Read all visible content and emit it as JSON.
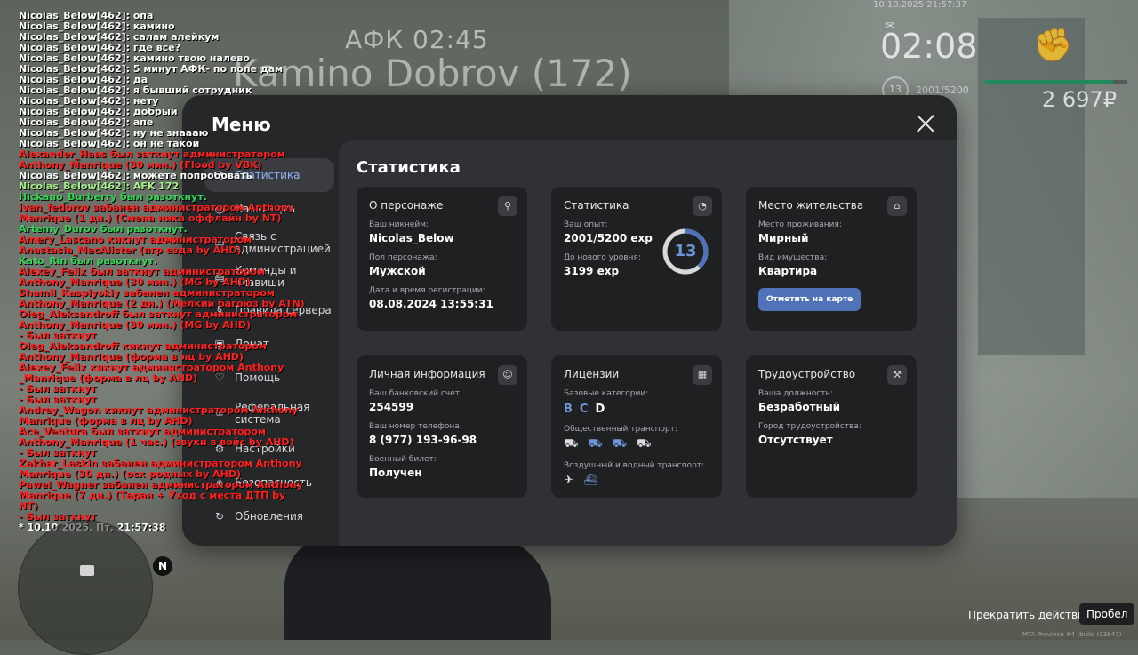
{
  "overlay": {
    "afk": "АФК 02:45",
    "nametag": "Kamino Dobrov (172)"
  },
  "hud": {
    "date": "10.10.2025 21:57:37",
    "time": "02:08",
    "level": "13",
    "exp": "2001/5200",
    "money": "2 697₽",
    "mail_icon": "mail-icon",
    "fist_icon": "fist-icon"
  },
  "menu": {
    "title": "Меню",
    "sidebar": [
      {
        "label": "Статистика",
        "icon": "chart-icon",
        "active": true
      },
      {
        "label": "Навигация",
        "icon": "compass-icon"
      },
      {
        "label": "Связь с администрацией",
        "icon": "chat-icon"
      },
      {
        "label": "Команды и клавиши",
        "icon": "keyboard-icon"
      },
      {
        "label": "Правила сервера",
        "icon": "rules-icon"
      },
      {
        "label": "Донат",
        "icon": "wallet-icon"
      },
      {
        "label": "Помощь",
        "icon": "help-icon"
      },
      {
        "label": "Реферальная система",
        "icon": "referral-icon"
      },
      {
        "label": "Настройки",
        "icon": "gear-icon"
      },
      {
        "label": "Безопасность",
        "icon": "shield-icon"
      },
      {
        "label": "Обновления",
        "icon": "refresh-icon"
      }
    ]
  },
  "stats": {
    "title": "Статистика",
    "character": {
      "title": "О персонаже",
      "nick_label": "Ваш никнейм:",
      "nick": "Nicolas_Below",
      "gender_label": "Пол персонажа:",
      "gender": "Мужской",
      "reg_label": "Дата и время регистрации:",
      "reg": "08.08.2024 13:55:31"
    },
    "statistics": {
      "title": "Статистика",
      "exp_label": "Ваш опыт:",
      "exp": "2001/5200 exp",
      "next_label": "До нового уровня:",
      "next": "3199 exp",
      "level": "13",
      "progress": 0.3848
    },
    "residence": {
      "title": "Место жительства",
      "place_label": "Место проживания:",
      "place": "Мирный",
      "property_label": "Вид имущества:",
      "property": "Квартира",
      "map_button": "Отметить на карте"
    },
    "personal": {
      "title": "Личная информация",
      "bank_label": "Ваш банковский счет:",
      "bank": "254599",
      "phone_label": "Ваш номер телефона:",
      "phone": "8 (977) 193-96-98",
      "military_label": "Военный билет:",
      "military": "Получен"
    },
    "licenses": {
      "title": "Лицензии",
      "base_label": "Базовые категории:",
      "cat_b": "B",
      "cat_c": "C",
      "cat_d": "D",
      "public_label": "Общественный транспорт:",
      "air_label": "Воздушный и водный транспорт:"
    },
    "employment": {
      "title": "Трудоустройство",
      "position_label": "Ваша должность:",
      "position": "Безработный",
      "city_label": "Город трудоустройства:",
      "city": "Отсутствует"
    }
  },
  "chat": [
    {
      "t": "Nicolas_Below[462]: опа",
      "c": "w"
    },
    {
      "t": "Nicolas_Below[462]: камино",
      "c": "w"
    },
    {
      "t": "Nicolas_Below[462]: салам алейкум",
      "c": "w"
    },
    {
      "t": "Nicolas_Below[462]: где все?",
      "c": "w"
    },
    {
      "t": "Nicolas_Below[462]: камино твою налево",
      "c": "w"
    },
    {
      "t": "Nicolas_Below[462]: 5 минут АФК- по попе дам",
      "c": "w"
    },
    {
      "t": "Nicolas_Below[462]: да",
      "c": "w"
    },
    {
      "t": "Nicolas_Below[462]: я бывший сотрудник",
      "c": "w"
    },
    {
      "t": "Nicolas_Below[462]: нету",
      "c": "w"
    },
    {
      "t": "Nicolas_Below[462]: добрый",
      "c": "w"
    },
    {
      "t": "Nicolas_Below[462]: апе",
      "c": "w"
    },
    {
      "t": "Nicolas_Below[462]: ну не знаааю",
      "c": "w"
    },
    {
      "t": "Nicolas_Below[462]: он не такой",
      "c": "w"
    },
    {
      "t": "Alexander_Haas был заткнут администратором",
      "c": "r"
    },
    {
      "t": " Anthony_Manrique (30 мин.) (Flood by VBK)",
      "c": "r"
    },
    {
      "t": "Nicolas_Below[462]: можете попробовать",
      "c": "w"
    },
    {
      "t": "Nicolas_Below[462]: AFK 172",
      "c": "gr"
    },
    {
      "t": "Hickano_Burberry был разоткнут.",
      "c": "g"
    },
    {
      "t": "Ivan_fedorov забанен администратором Anthony",
      "c": "r"
    },
    {
      "t": " Manrique (1 дн.) (Смена ника оффлайн by NT)",
      "c": "r"
    },
    {
      "t": "Artemy_Durov был разоткнут.",
      "c": "g"
    },
    {
      "t": "Amery_Lascano кикнут администратором",
      "c": "r"
    },
    {
      "t": " Anastasia_MacAlister (пгр езда by AHD)",
      "c": "r"
    },
    {
      "t": "Kato_Rin был разоткнут.",
      "c": "g"
    },
    {
      "t": "Alexey_Felix был заткнут администратором",
      "c": "r"
    },
    {
      "t": " Anthony_Manrique (30 мин.) (MG by AHD)",
      "c": "r"
    },
    {
      "t": "Shamil_Kaspiyskiy забанен администратором",
      "c": "r"
    },
    {
      "t": " Anthony_Manrique (2 дн.) (Мелкий багоюз by ATN)",
      "c": "r"
    },
    {
      "t": "Oleg_Aleksandroff был заткнут администратором",
      "c": "r"
    },
    {
      "t": " Anthony_Manrique (30 мин.) (MG by AHD)",
      "c": "r"
    },
    {
      "t": "- Был заткнут",
      "c": "r"
    },
    {
      "t": "Oleg_Aleksandroff кикнут администратором",
      "c": "r"
    },
    {
      "t": " Anthony_Manrique (форма в лц by AHD)",
      "c": "r"
    },
    {
      "t": "Alexey_Felix кикнут администратором Anthony",
      "c": "r"
    },
    {
      "t": " _Manrique (форма в лц by AHD)",
      "c": "r"
    },
    {
      "t": "- Был заткнут",
      "c": "r"
    },
    {
      "t": "- Был заткнут",
      "c": "r"
    },
    {
      "t": "Andrey_Wagon кикнут администратором Anthony",
      "c": "r"
    },
    {
      "t": " Manrique (форма в лц by AHD)",
      "c": "r"
    },
    {
      "t": "Ace_Ventura был заткнут администратором",
      "c": "r"
    },
    {
      "t": " Anthony_Manrique (1 час.) (звуки в войс by AHD)",
      "c": "r"
    },
    {
      "t": "- Был заткнут",
      "c": "r"
    },
    {
      "t": "Zakhar_Laskin забанен администратором Anthony",
      "c": "r"
    },
    {
      "t": " Manrique (30 дн.) (оск родных by AHD)",
      "c": "r"
    },
    {
      "t": "Pawel_Wagner забанен администратором Anthony",
      "c": "r"
    },
    {
      "t": " Manrique (7 дн.) (Таран + Уход с места ДТП by",
      "c": "r"
    },
    {
      "t": " NT)",
      "c": "r"
    },
    {
      "t": "- Был заткнут",
      "c": "r"
    },
    {
      "t": "* 10.10.2025, Пт, 21:57:38",
      "c": "w"
    }
  ],
  "bottom": {
    "stop_action": "Прекратить действие",
    "key": "Пробел",
    "watermark": "MTA Province #4 (build r23847)"
  }
}
